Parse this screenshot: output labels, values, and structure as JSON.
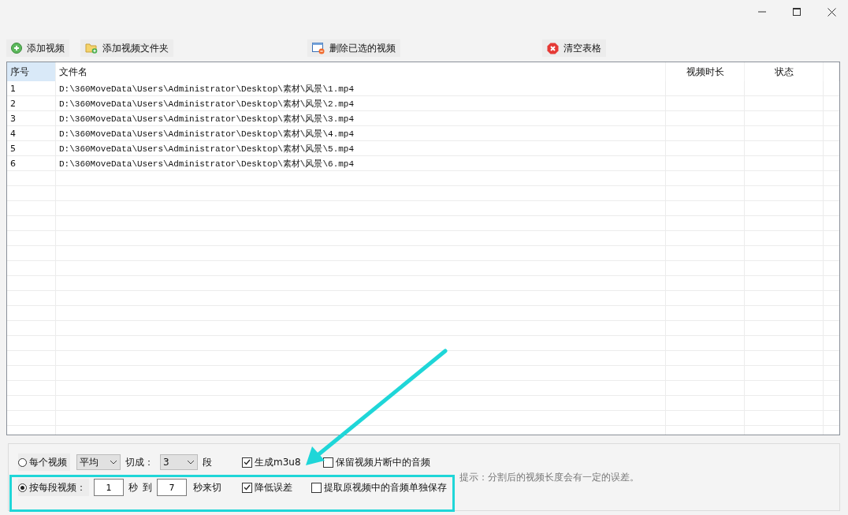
{
  "toolbar": [
    {
      "kind": "add",
      "label": "添加视频"
    },
    {
      "kind": "folder",
      "label": "添加视频文件夹"
    },
    {
      "kind": "delete",
      "label": "删除已选的视频"
    },
    {
      "kind": "clear",
      "label": "清空表格"
    }
  ],
  "table": {
    "columns": [
      {
        "label": "序号",
        "selected": true
      },
      {
        "label": "文件名",
        "selected": false
      },
      {
        "label": "视频时长",
        "selected": false
      },
      {
        "label": "状态",
        "selected": false
      }
    ],
    "rows": [
      {
        "index": "1",
        "file": "D:\\360MoveData\\Users\\Administrator\\Desktop\\素材\\风景\\1.mp4"
      },
      {
        "index": "2",
        "file": "D:\\360MoveData\\Users\\Administrator\\Desktop\\素材\\风景\\2.mp4"
      },
      {
        "index": "3",
        "file": "D:\\360MoveData\\Users\\Administrator\\Desktop\\素材\\风景\\3.mp4"
      },
      {
        "index": "4",
        "file": "D:\\360MoveData\\Users\\Administrator\\Desktop\\素材\\风景\\4.mp4"
      },
      {
        "index": "5",
        "file": "D:\\360MoveData\\Users\\Administrator\\Desktop\\素材\\风景\\5.mp4"
      },
      {
        "index": "6",
        "file": "D:\\360MoveData\\Users\\Administrator\\Desktop\\素材\\风景\\6.mp4"
      }
    ]
  },
  "options": {
    "per_video": {
      "label": "每个视频",
      "selected": false,
      "mode": "平均",
      "split_label": "切成：",
      "count": "3",
      "unit": "段"
    },
    "per_segment": {
      "label": "按每段视频：",
      "selected": true,
      "from": "1",
      "from_unit": "秒",
      "to_label": "到",
      "to": "7",
      "to_unit": "秒来切"
    },
    "checkboxes": [
      {
        "label": "生成m3u8",
        "checked": true
      },
      {
        "label": "保留视频片断中的音频",
        "checked": false
      },
      {
        "label": "降低误差",
        "checked": true
      },
      {
        "label": "提取原视频中的音频单独保存",
        "checked": false
      }
    ],
    "hint": "提示：分割后的视频长度会有一定的误差。"
  }
}
